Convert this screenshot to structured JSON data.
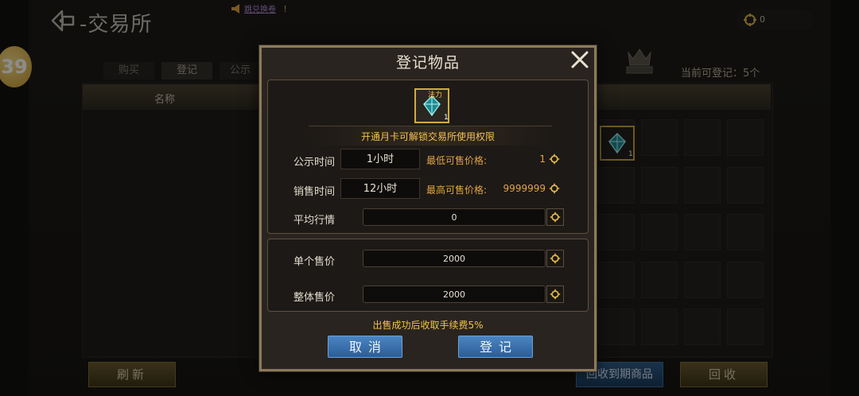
{
  "header": {
    "title": "-交易所",
    "notice_link": "跳兑换卷",
    "notice_suffix": "！",
    "currency_value": "0"
  },
  "level_badge": "39",
  "tabs": [
    {
      "label": "购买"
    },
    {
      "label": "登记",
      "active": true
    },
    {
      "label": "公示"
    }
  ],
  "register_count": "当前可登记：5个",
  "list": {
    "column_name": "名称"
  },
  "bag": {
    "item_tag": "法力",
    "item_count": "1"
  },
  "bottom_buttons": {
    "refresh": "刷新",
    "reclaim_expired": "回收到期商品",
    "reclaim": "回收"
  },
  "dialog": {
    "title": "登记物品",
    "item": {
      "tag": "法力",
      "count": "1"
    },
    "unlock_notice": "开通月卡可解锁交易所使用权限",
    "public_time_label": "公示时间",
    "public_time_value": "1小时",
    "sale_time_label": "销售时间",
    "sale_time_value": "12小时",
    "min_price_label": "最低可售价格:",
    "min_price_value": "1",
    "max_price_label": "最高可售价格:",
    "max_price_value": "9999999",
    "avg_label": "平均行情",
    "avg_value": "0",
    "unit_price_label": "单个售价",
    "unit_price_value": "2000",
    "total_price_label": "整体售价",
    "total_price_value": "2000",
    "fee_notice": "出售成功后收取手续费5%",
    "cancel_label": "取消",
    "confirm_label": "登记"
  },
  "colors": {
    "accent_gold": "#f2c24a",
    "price_orange": "#e0a445",
    "button_blue": "#3a72ad"
  },
  "icons": [
    "back-arrow-icon",
    "megaphone-icon",
    "coin-icon",
    "close-icon",
    "gem-icon",
    "crest-icon"
  ]
}
